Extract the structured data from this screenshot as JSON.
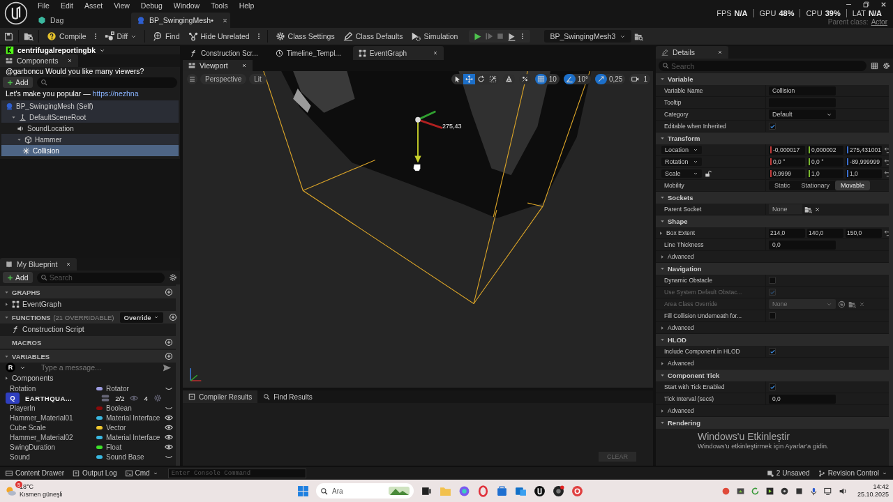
{
  "title_bar": {
    "menu": [
      "File",
      "Edit",
      "Asset",
      "View",
      "Debug",
      "Window",
      "Tools",
      "Help"
    ],
    "doc_tabs": [
      {
        "label": "Dag",
        "selected": false
      },
      {
        "label": "BP_SwingingMesh•",
        "selected": true
      }
    ],
    "stats": [
      {
        "label": "FPS",
        "value": "N/A"
      },
      {
        "label": "GPU",
        "value": "48%"
      },
      {
        "label": "CPU",
        "value": "39%"
      },
      {
        "label": "LAT",
        "value": "N/A"
      }
    ],
    "parent_class": {
      "label": "Parent class:",
      "value": "Actor"
    }
  },
  "toolbar": {
    "buttons": [
      {
        "label": "Compile",
        "kind": "compile",
        "more": true
      },
      {
        "label": "Diff",
        "kind": "diff",
        "dropdown": true
      },
      {
        "label": "Find",
        "kind": "find"
      },
      {
        "label": "Hide Unrelated",
        "kind": "hide",
        "more": true
      },
      {
        "label": "Class Settings",
        "kind": "settings"
      },
      {
        "label": "Class Defaults",
        "kind": "defaults"
      },
      {
        "label": "Simulation",
        "kind": "simulation"
      }
    ],
    "debug_object": "BP_SwingingMesh3"
  },
  "stream_chat": {
    "channel": "centrifugalreportingbk",
    "message": "@garboncu Would you like many viewers?",
    "promo": "Let's make you popular — ",
    "link": "https://nezhna"
  },
  "stream_bar": {
    "avatar": "R",
    "placeholder": "Type a message...",
    "badge": "Q",
    "channel": "EARTHQUA...",
    "scenes": "2/2",
    "viewers": "4"
  },
  "components": {
    "title": "Components",
    "add": "Add",
    "tree": [
      {
        "label": "BP_SwingingMesh (Self)",
        "kind": "self",
        "selected": false,
        "children": [
          {
            "label": "DefaultSceneRoot",
            "kind": "scene",
            "selected": false,
            "children": [
              {
                "label": "SoundLocation",
                "kind": "sound",
                "selected": false
              },
              {
                "label": "Hammer",
                "kind": "mesh",
                "selected": false,
                "children": [
                  {
                    "label": "Collision",
                    "kind": "collision",
                    "selected": true
                  }
                ]
              }
            ]
          }
        ]
      }
    ]
  },
  "graph_tabs": [
    {
      "label": "Construction Scr...",
      "kind": "function",
      "selected": false
    },
    {
      "label": "Timeline_Templ...",
      "kind": "timeline",
      "selected": false
    },
    {
      "label": "EventGraph",
      "kind": "graph",
      "selected": true
    }
  ],
  "viewport": {
    "tab": "Viewport",
    "view_mode": "Perspective",
    "lighting": "Lit",
    "tools": [
      {
        "kind": "select",
        "selected": false
      },
      {
        "kind": "move",
        "selected": true
      },
      {
        "kind": "rotate",
        "selected": false
      },
      {
        "kind": "scale",
        "selected": false
      }
    ],
    "snaps": [
      {
        "kind": "grid",
        "on": true,
        "value": "10"
      },
      {
        "kind": "angle",
        "on": true,
        "value": "10°"
      },
      {
        "kind": "scale",
        "on": true,
        "value": "0,25"
      }
    ],
    "camera_speed": "1",
    "gizmo_readout": "275,43"
  },
  "bottom_panel": {
    "tabs": [
      {
        "label": "Compiler Results",
        "kind": "compiler",
        "selected": true
      },
      {
        "label": "Find Results",
        "kind": "find",
        "selected": false
      }
    ],
    "clear": {
      "label": "CLEAR",
      "disabled": true
    }
  },
  "my_blueprint": {
    "title": "My Blueprint",
    "add": "Add",
    "search_placeholder": "Search",
    "sections": [
      {
        "kind": "graphs",
        "title": "GRAPHS",
        "items": [
          {
            "label": "EventGraph"
          }
        ]
      },
      {
        "kind": "functions",
        "title": "FUNCTIONS",
        "note": "(21 OVERRIDABLE)",
        "override": "Override",
        "items": [
          {
            "label": "Construction Script"
          }
        ]
      },
      {
        "kind": "macros",
        "title": "MACROS"
      },
      {
        "kind": "variables",
        "title": "VARIABLES",
        "category": "Components",
        "variables": [
          {
            "name": "Rotation",
            "type": "Rotator",
            "color": "#9b9be0",
            "visible": false
          },
          {
            "name": "PlayerIn",
            "type": "Boolean",
            "color": "#8a0a0a",
            "visible": false
          },
          {
            "name": "Hammer_Material01",
            "type": "Material Interface",
            "color": "#3ab8e0",
            "visible": true
          },
          {
            "name": "Cube Scale",
            "type": "Vector",
            "color": "#f0c830",
            "visible": true
          },
          {
            "name": "Hammer_Material02",
            "type": "Material Interface",
            "color": "#3ab8e0",
            "visible": true
          },
          {
            "name": "SwingDuration",
            "type": "Float",
            "color": "#3ee02a",
            "visible": true
          },
          {
            "name": "Sound",
            "type": "Sound Base",
            "color": "#3ab8e0",
            "visible": false
          }
        ]
      }
    ]
  },
  "details": {
    "title": "Details",
    "search_placeholder": "Search",
    "rows": [
      {
        "kind": "section",
        "label": "Variable"
      },
      {
        "kind": "text",
        "label": "Variable Name",
        "value": "Collision"
      },
      {
        "kind": "text",
        "label": "Tooltip"
      },
      {
        "kind": "dropdown",
        "label": "Category",
        "value": "Default",
        "disabled": false
      },
      {
        "kind": "check",
        "label": "Editable when Inherited",
        "checked": true,
        "disabled": false
      },
      {
        "kind": "section",
        "label": "Transform"
      },
      {
        "kind": "vector",
        "label": "Location",
        "label_menu": true,
        "axis_marks": true,
        "values": [
          "-0,000017",
          "0,000002",
          "275,431001"
        ],
        "resettable": true
      },
      {
        "kind": "vector",
        "label": "Rotation",
        "label_menu": true,
        "axis_marks": true,
        "values": [
          "0,0 °",
          "0,0 °",
          "-89,999999"
        ],
        "resettable": true
      },
      {
        "kind": "vector",
        "label": "Scale",
        "label_menu": true,
        "axis_marks": true,
        "locked": false,
        "values": [
          "0,9999",
          "1,0",
          "1,0"
        ],
        "resettable": true
      },
      {
        "kind": "segmented",
        "label": "Mobility",
        "options": [
          {
            "label": "Static",
            "selected": false
          },
          {
            "label": "Stationary",
            "selected": false
          },
          {
            "label": "Movable",
            "selected": true
          }
        ]
      },
      {
        "kind": "section",
        "label": "Sockets"
      },
      {
        "kind": "picker",
        "label": "Parent Socket",
        "value": "None"
      },
      {
        "kind": "section",
        "label": "Shape"
      },
      {
        "kind": "vector",
        "label": "Box Extent",
        "label_menu": false,
        "expandable": true,
        "axis_marks": false,
        "values": [
          "214,0",
          "140,0",
          "150,0"
        ],
        "resettable": true
      },
      {
        "kind": "text",
        "label": "Line Thickness",
        "value": "0,0"
      },
      {
        "kind": "advanced",
        "label": "Advanced"
      },
      {
        "kind": "section",
        "label": "Navigation"
      },
      {
        "kind": "check",
        "label": "Dynamic Obstacle",
        "checked": false,
        "disabled": false
      },
      {
        "kind": "check",
        "label": "Use System Default Obstac...",
        "checked": true,
        "disabled": true
      },
      {
        "kind": "dropdown",
        "label": "Area Class Override",
        "value": "None",
        "disabled": true,
        "tools": true
      },
      {
        "kind": "check",
        "label": "Fill Collision Underneath for...",
        "checked": false,
        "disabled": false
      },
      {
        "kind": "advanced",
        "label": "Advanced"
      },
      {
        "kind": "section",
        "label": "HLOD"
      },
      {
        "kind": "check",
        "label": "Include Component in HLOD",
        "checked": true,
        "disabled": false
      },
      {
        "kind": "advanced",
        "label": "Advanced"
      },
      {
        "kind": "section",
        "label": "Component Tick"
      },
      {
        "kind": "check",
        "label": "Start with Tick Enabled",
        "checked": true,
        "disabled": false
      },
      {
        "kind": "text",
        "label": "Tick Interval (secs)",
        "value": "0,0"
      },
      {
        "kind": "advanced",
        "label": "Advanced"
      },
      {
        "kind": "section",
        "label": "Rendering"
      }
    ]
  },
  "os_notice": {
    "title": "Windows'u Etkinleştir",
    "text": "Windows'u etkinleştirmek için Ayarlar'a gidin."
  },
  "status_bar": {
    "left": [
      {
        "label": "Content Drawer",
        "kind": "drawer"
      },
      {
        "label": "Output Log",
        "kind": "log"
      },
      {
        "label": "Cmd",
        "kind": "cmd"
      }
    ],
    "console_placeholder": "Enter Console Command",
    "right": [
      {
        "label": "2 Unsaved",
        "kind": "unsaved"
      },
      {
        "label": "Revision Control",
        "kind": "revision"
      }
    ]
  },
  "taskbar": {
    "weather": {
      "badge": "5",
      "temp": "18°C",
      "condition": "Kısmen güneşli"
    },
    "search_placeholder": "Ara",
    "time": "14:42",
    "date": "25.10.2025"
  }
}
